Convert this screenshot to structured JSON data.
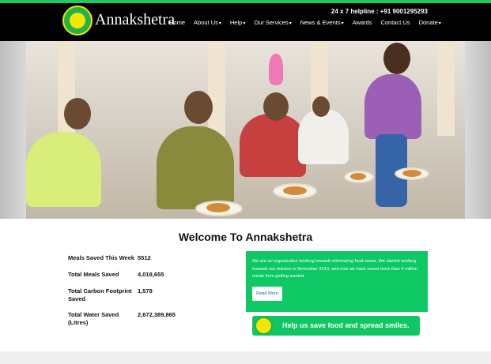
{
  "header": {
    "brand": "Annakshetra",
    "logo_text": "ANNAKSHETRA SAVE FOOD",
    "helpline": "24 x 7 helpline : +91 9001295293",
    "nav": [
      {
        "label": "Home",
        "dropdown": false
      },
      {
        "label": "About Us",
        "dropdown": true
      },
      {
        "label": "Help",
        "dropdown": true
      },
      {
        "label": "Our Services",
        "dropdown": true
      },
      {
        "label": "News & Events",
        "dropdown": true
      },
      {
        "label": "Awards",
        "dropdown": false
      },
      {
        "label": "Contact Us",
        "dropdown": false
      },
      {
        "label": "Donate",
        "dropdown": true
      }
    ],
    "caret_glyph": "▾"
  },
  "main": {
    "welcome_title": "Welcome To Annakshetra",
    "stats": [
      {
        "label": "Meals Saved This Week",
        "value": "5512"
      },
      {
        "label": "Total Meals Saved",
        "value": "4,018,655"
      },
      {
        "label": "Total Carbon Footprint Saved",
        "value": "1,578"
      },
      {
        "label": "Total Water Saved (Litres)",
        "value": "2,672,389,865"
      }
    ],
    "about_text": "We are an organization working towards eliminating food waste. We started working towards our mission in November 2010, and now we have saved more than 4 million meals from getting wasted.",
    "read_more": "Read More",
    "banner_text": "Help us save food and spread smiles."
  },
  "colors": {
    "accent_green": "#0ec864",
    "navbar": "#000000",
    "logo_yellow": "#f4e600"
  }
}
